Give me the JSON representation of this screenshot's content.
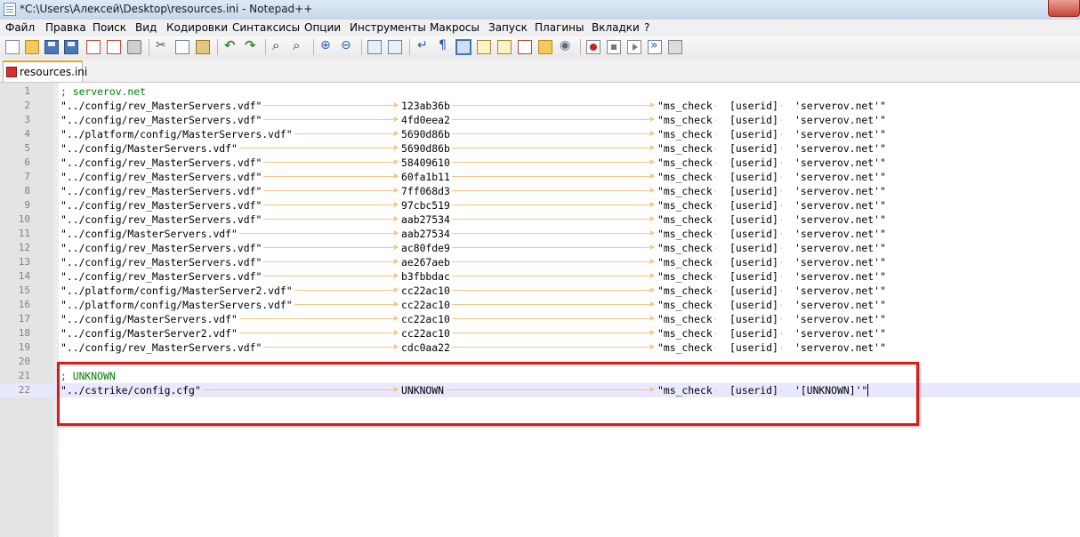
{
  "window": {
    "title": "*C:\\Users\\Алексей\\Desktop\\resources.ini - Notepad++"
  },
  "menu": [
    "Файл",
    "Правка",
    "Поиск",
    "Вид",
    "Кодировки",
    "Синтаксисы",
    "Опции",
    "Инструменты",
    "Макросы",
    "Запуск",
    "Плагины",
    "Вкладки",
    "?"
  ],
  "tab": {
    "label": "resources.ini"
  },
  "toolbar_icons": [
    "new-file-icon",
    "open-file-icon",
    "save-icon",
    "save-all-icon",
    "close-file-icon",
    "close-all-icon",
    "print-icon",
    "cut-icon",
    "copy-icon",
    "paste-icon",
    "undo-icon",
    "redo-icon",
    "find-icon",
    "replace-icon",
    "zoom-in-icon",
    "zoom-out-icon",
    "sync-vertical-icon",
    "sync-horizontal-icon",
    "word-wrap-icon",
    "show-all-chars-icon",
    "indent-guide-icon",
    "user-language-icon",
    "document-map-icon",
    "function-list-icon",
    "folder-workspace-icon",
    "monitoring-icon",
    "record-macro-icon",
    "stop-recording-icon",
    "playback-macro-icon",
    "run-macro-multiple-icon",
    "save-macro-icon"
  ],
  "editor": {
    "lines": [
      {
        "num": "1",
        "comment": "; serverov.net"
      },
      {
        "num": "2",
        "path": "\"../config/rev_MasterServers.vdf\"",
        "hash": "123ab36b",
        "cmd": "\"ms_check",
        "arg1": "[userid]",
        "arg2": "'serverov.net'\""
      },
      {
        "num": "3",
        "path": "\"../config/rev_MasterServers.vdf\"",
        "hash": "4fd0eea2",
        "cmd": "\"ms_check",
        "arg1": "[userid]",
        "arg2": "'serverov.net'\""
      },
      {
        "num": "4",
        "path": "\"../platform/config/MasterServers.vdf\"",
        "hash": "5690d86b",
        "cmd": "\"ms_check",
        "arg1": "[userid]",
        "arg2": "'serverov.net'\""
      },
      {
        "num": "5",
        "path": "\"../config/MasterServers.vdf\"",
        "hash": "5690d86b",
        "cmd": "\"ms_check",
        "arg1": "[userid]",
        "arg2": "'serverov.net'\""
      },
      {
        "num": "6",
        "path": "\"../config/rev_MasterServers.vdf\"",
        "hash": "58409610",
        "cmd": "\"ms_check",
        "arg1": "[userid]",
        "arg2": "'serverov.net'\""
      },
      {
        "num": "7",
        "path": "\"../config/rev_MasterServers.vdf\"",
        "hash": "60fa1b11",
        "cmd": "\"ms_check",
        "arg1": "[userid]",
        "arg2": "'serverov.net'\""
      },
      {
        "num": "8",
        "path": "\"../config/rev_MasterServers.vdf\"",
        "hash": "7ff068d3",
        "cmd": "\"ms_check",
        "arg1": "[userid]",
        "arg2": "'serverov.net'\""
      },
      {
        "num": "9",
        "path": "\"../config/rev_MasterServers.vdf\"",
        "hash": "97cbc519",
        "cmd": "\"ms_check",
        "arg1": "[userid]",
        "arg2": "'serverov.net'\""
      },
      {
        "num": "10",
        "path": "\"../config/rev_MasterServers.vdf\"",
        "hash": "aab27534",
        "cmd": "\"ms_check",
        "arg1": "[userid]",
        "arg2": "'serverov.net'\""
      },
      {
        "num": "11",
        "path": "\"../config/MasterServers.vdf\"",
        "hash": "aab27534",
        "cmd": "\"ms_check",
        "arg1": "[userid]",
        "arg2": "'serverov.net'\""
      },
      {
        "num": "12",
        "path": "\"../config/rev_MasterServers.vdf\"",
        "hash": "ac80fde9",
        "cmd": "\"ms_check",
        "arg1": "[userid]",
        "arg2": "'serverov.net'\""
      },
      {
        "num": "13",
        "path": "\"../config/rev_MasterServers.vdf\"",
        "hash": "ae267aeb",
        "cmd": "\"ms_check",
        "arg1": "[userid]",
        "arg2": "'serverov.net'\""
      },
      {
        "num": "14",
        "path": "\"../config/rev_MasterServers.vdf\"",
        "hash": "b3fbbdac",
        "cmd": "\"ms_check",
        "arg1": "[userid]",
        "arg2": "'serverov.net'\""
      },
      {
        "num": "15",
        "path": "\"../platform/config/MasterServer2.vdf\"",
        "hash": "cc22ac10",
        "cmd": "\"ms_check",
        "arg1": "[userid]",
        "arg2": "'serverov.net'\""
      },
      {
        "num": "16",
        "path": "\"../platform/config/MasterServers.vdf\"",
        "hash": "cc22ac10",
        "cmd": "\"ms_check",
        "arg1": "[userid]",
        "arg2": "'serverov.net'\""
      },
      {
        "num": "17",
        "path": "\"../config/MasterServers.vdf\"",
        "hash": "cc22ac10",
        "cmd": "\"ms_check",
        "arg1": "[userid]",
        "arg2": "'serverov.net'\""
      },
      {
        "num": "18",
        "path": "\"../config/MasterServer2.vdf\"",
        "hash": "cc22ac10",
        "cmd": "\"ms_check",
        "arg1": "[userid]",
        "arg2": "'serverov.net'\""
      },
      {
        "num": "19",
        "path": "\"../config/rev_MasterServers.vdf\"",
        "hash": "cdc0aa22",
        "cmd": "\"ms_check",
        "arg1": "[userid]",
        "arg2": "'serverov.net'\""
      },
      {
        "num": "20"
      },
      {
        "num": "21",
        "comment": "; UNKNOWN"
      },
      {
        "num": "22",
        "path": "\"../cstrike/config.cfg\"",
        "hash": "UNKNOWN",
        "cmd": "\"ms_check",
        "arg1": "[userid]",
        "arg2": "'[UNKNOWN]'\"",
        "current": true
      }
    ]
  },
  "annotation": {
    "color": "#d81a1a"
  }
}
